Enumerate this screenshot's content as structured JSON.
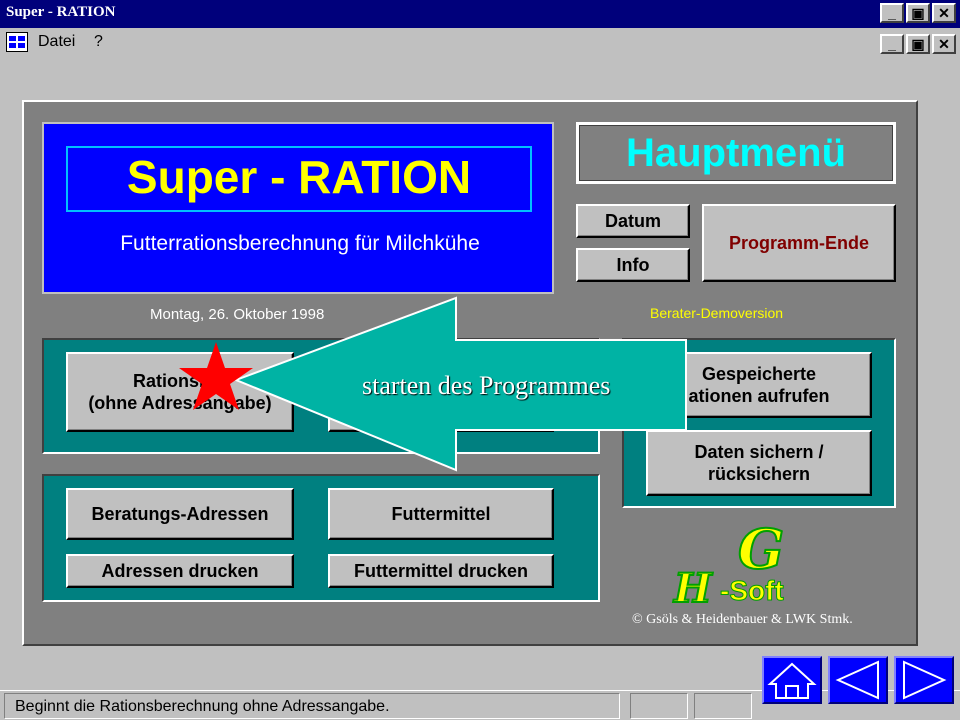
{
  "window": {
    "title": "Super - RATION"
  },
  "menu": {
    "items": [
      "Datei",
      "?"
    ]
  },
  "banner": {
    "title": "Super - RATION",
    "subtitle": "Futterrationsberechnung für Milchkühe",
    "date": "Montag, 26. Oktober 1998"
  },
  "header": {
    "hauptmenu": "Hauptmenü",
    "demo": "Berater-Demoversion"
  },
  "buttons": {
    "datum": "Datum",
    "info": "Info",
    "ende": "Programm-Ende",
    "rations_line1": "Rationsber",
    "rations_line2": "(ohne Adressangabe)",
    "gespeichert_line1": "Gespeicherte",
    "gespeichert_line2": "ationen aufrufen",
    "sichern_line1": "Daten sichern /",
    "sichern_line2": "rücksichern",
    "adressen": "Beratungs-Adressen",
    "futtermittel": "Futtermittel",
    "adressen_drucken": "Adressen drucken",
    "futtermittel_drucken": "Futtermittel drucken"
  },
  "annotation": {
    "text": "starten des Programmes"
  },
  "logo": {
    "mark": "HG",
    "text": "-Soft",
    "copyright": "© Gsöls & Heidenbauer & LWK Stmk."
  },
  "status": {
    "text": "Beginnt die Rationsberechnung ohne Adressangabe."
  },
  "colors": {
    "title_bar": "#00007b",
    "banner_blue": "#0000ff",
    "banner_text": "#ffff00",
    "panel_teal": "#008080",
    "hauptmenu_cyan": "#00ffff",
    "arrow_teal": "#00b3a4",
    "star_red": "#ff0000",
    "ende_text": "#800000"
  }
}
